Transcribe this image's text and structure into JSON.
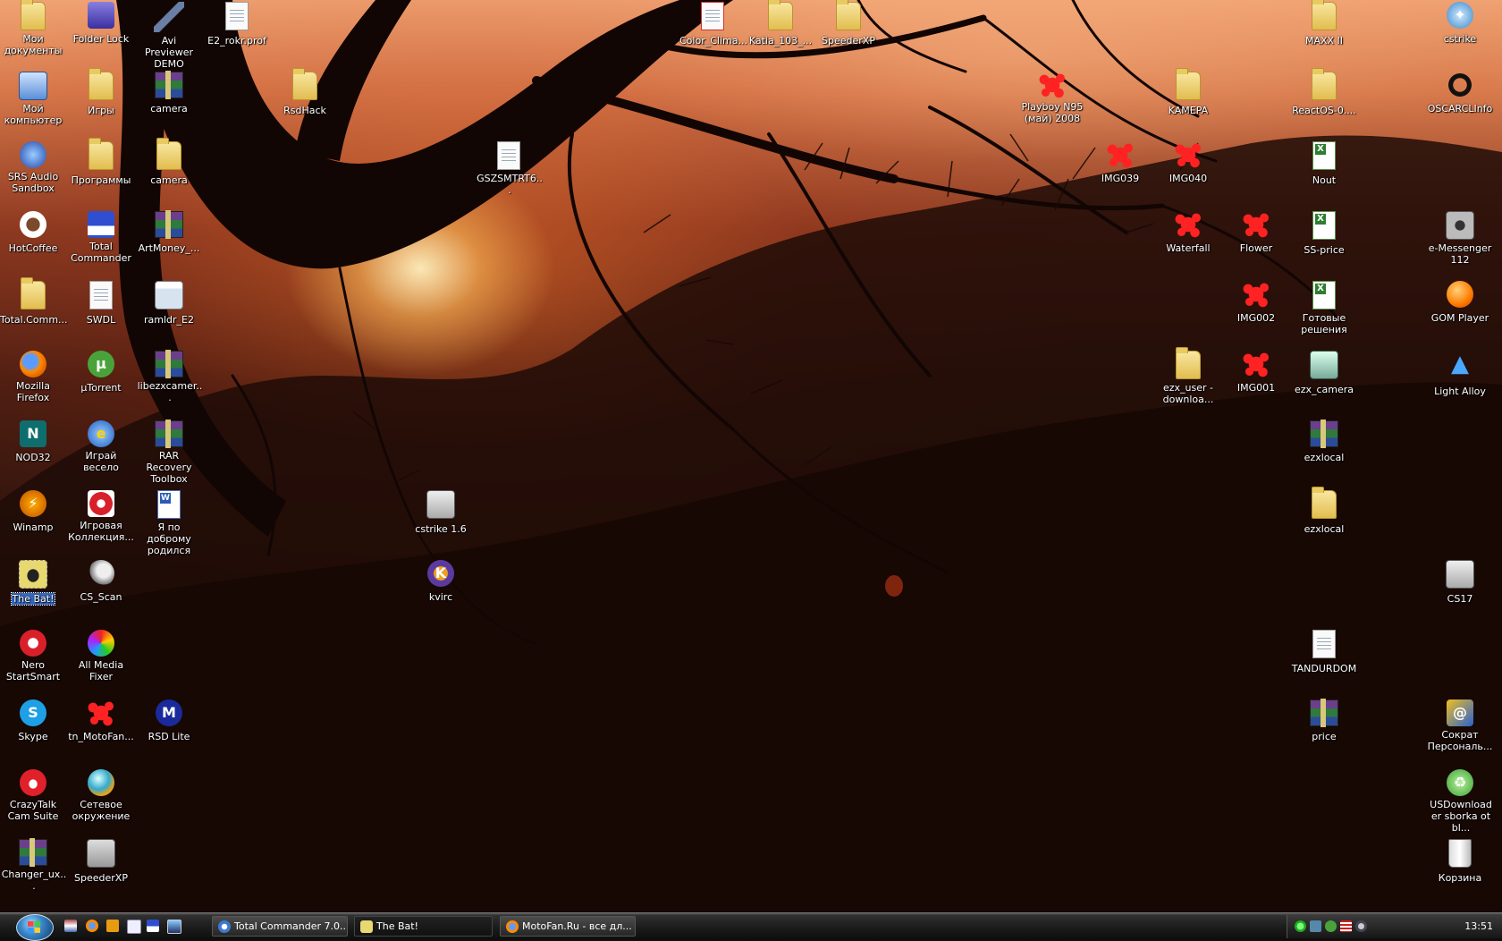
{
  "desktop": {
    "icons": [
      {
        "label": "Мои документы",
        "icon": "folder-icon"
      },
      {
        "label": "Folder Lock",
        "icon": "folder-lock-icon"
      },
      {
        "label": "Avi Previewer DEMO",
        "icon": "avi-previewer-icon"
      },
      {
        "label": "E2_rokr.prof",
        "icon": "file-icon"
      },
      {
        "label": "Мой компьютер",
        "icon": "computer-icon"
      },
      {
        "label": "Игры",
        "icon": "folder-icon"
      },
      {
        "label": "camera",
        "icon": "archive-icon"
      },
      {
        "label": "RsdHack",
        "icon": "folder-icon"
      },
      {
        "label": "SRS Audio Sandbox",
        "icon": "srs-audio-icon"
      },
      {
        "label": "Программы",
        "icon": "folder-icon"
      },
      {
        "label": "camera",
        "icon": "folder-icon"
      },
      {
        "label": "HotCoffee",
        "icon": "coffee-icon"
      },
      {
        "label": "Total Commander",
        "icon": "floppy-icon"
      },
      {
        "label": "ArtMoney_...",
        "icon": "archive-icon"
      },
      {
        "label": "Total.Comm...",
        "icon": "folder-icon"
      },
      {
        "label": "SWDL",
        "icon": "text-file-icon"
      },
      {
        "label": "ramldr_E2",
        "icon": "app-icon"
      },
      {
        "label": "Mozilla Firefox",
        "icon": "firefox-icon"
      },
      {
        "label": "µTorrent",
        "icon": "utorrent-icon"
      },
      {
        "label": "libezxcamer...",
        "icon": "archive-icon"
      },
      {
        "label": "NOD32",
        "icon": "nod32-icon"
      },
      {
        "label": "Играй весело",
        "icon": "internet-explorer-icon"
      },
      {
        "label": "RAR Recovery Toolbox",
        "icon": "rar-recovery-icon"
      },
      {
        "label": "Winamp",
        "icon": "winamp-icon"
      },
      {
        "label": "Игровая Коллекция...",
        "icon": "game-collection-icon"
      },
      {
        "label": "Я по доброму родился",
        "icon": "word-document-icon"
      },
      {
        "label": "The Bat!",
        "icon": "the-bat-icon"
      },
      {
        "label": "CS_Scan",
        "icon": "satellite-icon"
      },
      {
        "label": "Nero StartSmart",
        "icon": "nero-icon"
      },
      {
        "label": "All Media Fixer",
        "icon": "media-fixer-icon"
      },
      {
        "label": "Skype",
        "icon": "skype-icon"
      },
      {
        "label": "tn_MotoFan...",
        "icon": "splat-image-icon"
      },
      {
        "label": "RSD Lite",
        "icon": "motorola-icon"
      },
      {
        "label": "CrazyTalk Cam Suite",
        "icon": "crazytalk-icon"
      },
      {
        "label": "Сетевое окружение",
        "icon": "network-icon"
      },
      {
        "label": "Changer_ux...",
        "icon": "archive-icon"
      },
      {
        "label": "SpeederXP",
        "icon": "speederxp-icon"
      },
      {
        "label": "GSZSMTRT6...",
        "icon": "file-icon"
      },
      {
        "label": "cstrike 1.6",
        "icon": "counter-strike-icon"
      },
      {
        "label": "kvirc",
        "icon": "kvirc-icon"
      },
      {
        "label": "Color_Clima...",
        "icon": "pdf-icon"
      },
      {
        "label": "Katia_103_...",
        "icon": "folder-icon"
      },
      {
        "label": "SpeederXP",
        "icon": "folder-icon"
      },
      {
        "label": "Playboy N95 (май) 2008",
        "icon": "splat-image-icon"
      },
      {
        "label": "KAMEPA",
        "icon": "folder-icon"
      },
      {
        "label": "IMG039",
        "icon": "splat-image-icon"
      },
      {
        "label": "IMG040",
        "icon": "splat-image-icon"
      },
      {
        "label": "Waterfall",
        "icon": "splat-image-icon"
      },
      {
        "label": "ezx_user - downloa...",
        "icon": "folder-icon"
      },
      {
        "label": "Flower",
        "icon": "splat-image-icon"
      },
      {
        "label": "IMG002",
        "icon": "splat-image-icon"
      },
      {
        "label": "IMG001",
        "icon": "splat-image-icon"
      },
      {
        "label": "MAXX II",
        "icon": "folder-icon"
      },
      {
        "label": "ReactOS-0....",
        "icon": "folder-icon"
      },
      {
        "label": "Nout",
        "icon": "excel-icon"
      },
      {
        "label": "SS-price",
        "icon": "excel-icon"
      },
      {
        "label": "Готовые решения",
        "icon": "excel-icon"
      },
      {
        "label": "ezx_camera",
        "icon": "app-icon"
      },
      {
        "label": "ezxlocal",
        "icon": "archive-icon"
      },
      {
        "label": "ezxlocal",
        "icon": "folder-icon"
      },
      {
        "label": "TANDURDOM",
        "icon": "text-file-icon"
      },
      {
        "label": "price",
        "icon": "archive-icon"
      },
      {
        "label": "cstrike",
        "icon": "cstrike-icon"
      },
      {
        "label": "OSCARCLInfo",
        "icon": "oscar-icon"
      },
      {
        "label": "e-Messenger 112",
        "icon": "camera-icon"
      },
      {
        "label": "GOM Player",
        "icon": "gom-player-icon"
      },
      {
        "label": "Light Alloy",
        "icon": "light-alloy-icon"
      },
      {
        "label": "CS17",
        "icon": "counter-strike-icon"
      },
      {
        "label": "Сократ Персональ...",
        "icon": "socrat-icon"
      },
      {
        "label": "USDownloader sborka ot bl...",
        "icon": "usdownloader-icon"
      },
      {
        "label": "Корзина",
        "icon": "recycle-bin-icon"
      }
    ]
  },
  "taskbar": {
    "start_icon": "windows-start-icon",
    "quick_launch": [
      "rar-icon",
      "firefox-icon",
      "winamp-icon",
      "notepad-icon",
      "floppy-icon",
      "desktop-icon"
    ],
    "tasks": [
      {
        "label": "Total Commander 7.0...",
        "icon": "total-commander-icon"
      },
      {
        "label": "The Bat!",
        "icon": "the-bat-icon"
      },
      {
        "label": "MotoFan.Ru - все дл...",
        "icon": "firefox-icon"
      }
    ],
    "tray_icons": [
      "clover-icon",
      "network-icon",
      "utorrent-icon",
      "language-us-icon",
      "speaker-icon"
    ],
    "clock": "13:51"
  }
}
